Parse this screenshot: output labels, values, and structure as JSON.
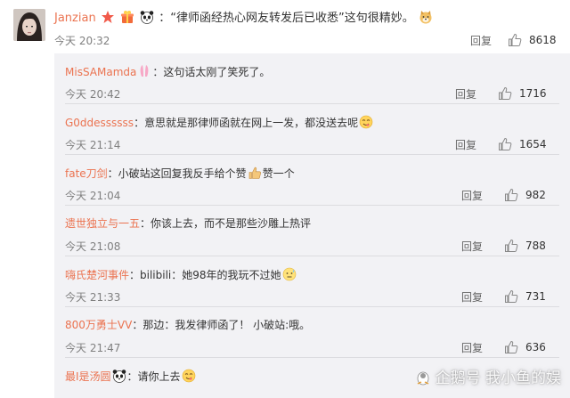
{
  "main_comment": {
    "username": "Janzian",
    "text": "：“律师函经热心网友转发后已收悉”这句很精妙。",
    "time": "今天 20:32",
    "reply_label": "回复",
    "likes": "8618"
  },
  "replies": [
    {
      "username": "MisSAMamda",
      "text": "：这句话太刚了笑死了。",
      "time": "今天 20:42",
      "reply_label": "回复",
      "likes": "1716"
    },
    {
      "username": "G0ddessssss",
      "text": "：意思就是那律师函就在网上一发，都没送去呢",
      "time": "今天 21:14",
      "reply_label": "回复",
      "likes": "1654"
    },
    {
      "username": "fate刀剑",
      "text": "：小破站这回复我反手给个赞",
      "text2": "赞一个",
      "time": "今天 21:04",
      "reply_label": "回复",
      "likes": "982"
    },
    {
      "username": "遗世独立与一五",
      "text": "：你该上去，而不是那些沙雕上热评",
      "time": "今天 21:08",
      "reply_label": "回复",
      "likes": "788"
    },
    {
      "username": "嗨氏楚河事件",
      "text": "：bilibili：她98年的我玩不过她",
      "time": "今天 21:33",
      "reply_label": "回复",
      "likes": "731"
    },
    {
      "username": "800万勇士VV",
      "text": "：那边：我发律师函了！ 小破站:哦。",
      "time": "今天 21:47",
      "reply_label": "回复",
      "likes": "636"
    },
    {
      "username": "最I是汤圆",
      "text": "：请你上去",
      "time": "",
      "reply_label": "",
      "likes": ""
    }
  ],
  "watermark": "企鹅号 我小鱼的娱",
  "colors": {
    "username": "#eb7350",
    "reply_bg": "#f2f2f5",
    "time": "#808080"
  }
}
